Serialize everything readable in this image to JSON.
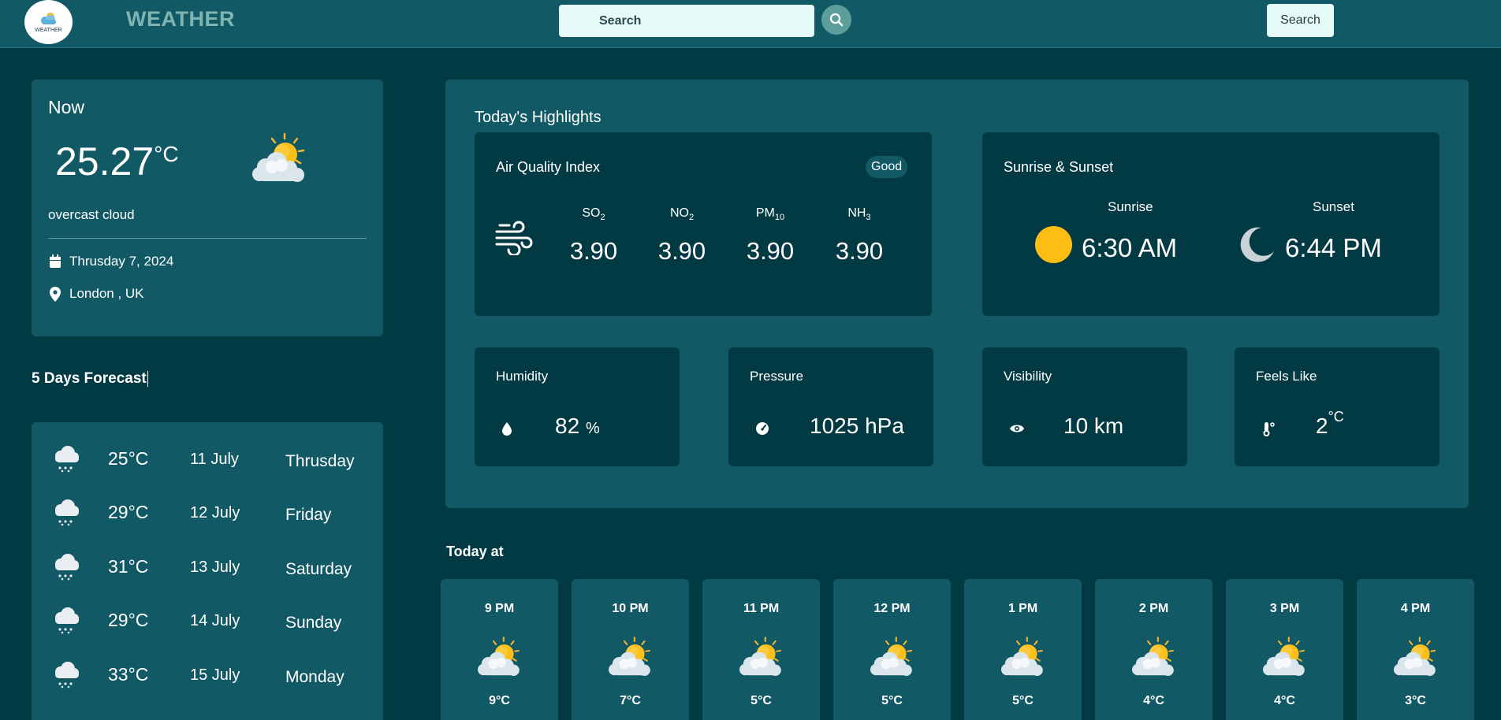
{
  "header": {
    "logo_text": "WEATHER",
    "brand": "WEATHER",
    "search_placeholder": "Search",
    "search_button": "Search"
  },
  "now": {
    "label": "Now",
    "temp": "25.27",
    "unit": "°C",
    "description": "overcast cloud",
    "date": "Thrusday 7, 2024",
    "location": "London , UK",
    "icon": "partly-cloudy-icon"
  },
  "forecast": {
    "title": "5 Days Forecast",
    "days": [
      {
        "temp": "25°C",
        "date": "11 July",
        "day": "Thrusday",
        "icon": "snow-cloud-icon"
      },
      {
        "temp": "29°C",
        "date": "12 July",
        "day": "Friday",
        "icon": "snow-cloud-icon"
      },
      {
        "temp": "31°C",
        "date": "13 July",
        "day": "Saturday",
        "icon": "snow-cloud-icon"
      },
      {
        "temp": "29°C",
        "date": "14 July",
        "day": "Sunday",
        "icon": "snow-cloud-icon"
      },
      {
        "temp": "33°C",
        "date": "15 July",
        "day": "Monday",
        "icon": "snow-cloud-icon"
      }
    ]
  },
  "highlights": {
    "title": "Today's Highlights",
    "air_quality": {
      "title": "Air Quality Index",
      "badge": "Good",
      "items": [
        {
          "name": "SO",
          "sub": "2",
          "value": "3.90"
        },
        {
          "name": "NO",
          "sub": "2",
          "value": "3.90"
        },
        {
          "name": "PM",
          "sub": "10",
          "value": "3.90"
        },
        {
          "name": "NH",
          "sub": "3",
          "value": "3.90"
        }
      ]
    },
    "sun": {
      "title": "Sunrise & Sunset",
      "sunrise_label": "Sunrise",
      "sunrise_time": "6:30 AM",
      "sunset_label": "Sunset",
      "sunset_time": "6:44 PM"
    },
    "humidity": {
      "title": "Humidity",
      "value": "82",
      "unit": "%"
    },
    "pressure": {
      "title": "Pressure",
      "value": "1025 hPa"
    },
    "visibility": {
      "title": "Visibility",
      "value": "10 km"
    },
    "feels_like": {
      "title": "Feels Like",
      "value": "2",
      "unit": "°C"
    }
  },
  "today": {
    "title": "Today at",
    "hours": [
      {
        "time": "9 PM",
        "temp": "9°C"
      },
      {
        "time": "10 PM",
        "temp": "7°C"
      },
      {
        "time": "11 PM",
        "temp": "5°C"
      },
      {
        "time": "12 PM",
        "temp": "5°C"
      },
      {
        "time": "1 PM",
        "temp": "5°C"
      },
      {
        "time": "2 PM",
        "temp": "4°C"
      },
      {
        "time": "3 PM",
        "temp": "4°C"
      },
      {
        "time": "4 PM",
        "temp": "3°C"
      }
    ]
  },
  "colors": {
    "background": "#023a44",
    "card": "#125966",
    "accent_sun": "#fdbd14",
    "brand": "#7fb4b0"
  }
}
